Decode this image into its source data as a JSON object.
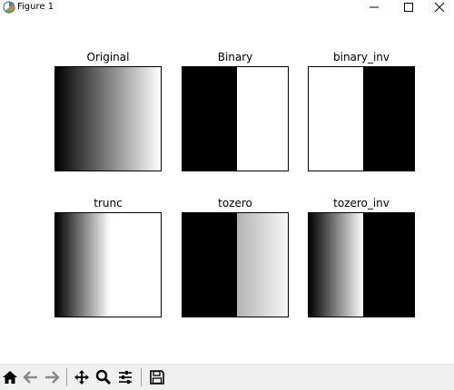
{
  "window": {
    "title": "Figure 1",
    "controls": [
      "minimize",
      "maximize",
      "close"
    ]
  },
  "figure": {
    "subplots": [
      {
        "title": "Original",
        "mode": "gradient"
      },
      {
        "title": "Binary",
        "mode": "binary"
      },
      {
        "title": "binary_inv",
        "mode": "binary_inv"
      },
      {
        "title": "trunc",
        "mode": "trunc"
      },
      {
        "title": "tozero",
        "mode": "tozero"
      },
      {
        "title": "tozero_inv",
        "mode": "tozero_inv"
      }
    ],
    "threshold_fraction": 0.52
  },
  "toolbar": {
    "buttons": [
      "home-icon",
      "back-icon",
      "forward-icon",
      "pan-icon",
      "zoom-icon",
      "configure-subplots-icon",
      "save-icon"
    ]
  }
}
